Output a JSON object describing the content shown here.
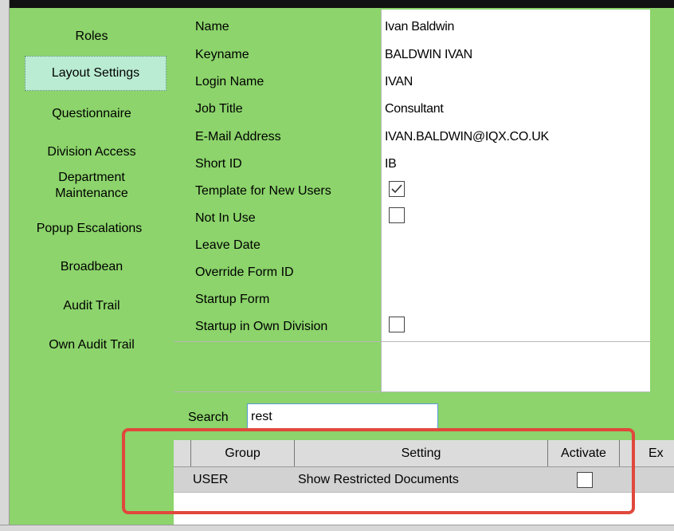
{
  "sidebar": {
    "items": [
      {
        "label": "Roles"
      },
      {
        "label": "Layout Settings"
      },
      {
        "label": "Questionnaire"
      },
      {
        "label": "Division Access"
      },
      {
        "label": "Department"
      },
      {
        "label": "Maintenance"
      },
      {
        "label": "Popup Escalations"
      },
      {
        "label": "Broadbean"
      },
      {
        "label": "Audit Trail"
      },
      {
        "label": "Own Audit Trail"
      }
    ]
  },
  "properties": [
    {
      "label": "Name",
      "value": "Ivan Baldwin"
    },
    {
      "label": "Keyname",
      "value": "BALDWIN IVAN"
    },
    {
      "label": "Login Name",
      "value": "IVAN"
    },
    {
      "label": "Job Title",
      "value": "Consultant"
    },
    {
      "label": "E-Mail Address",
      "value": "IVAN.BALDWIN@IQX.CO.UK"
    },
    {
      "label": "Short ID",
      "value": "IB"
    },
    {
      "label": "Template for New Users",
      "checked": true
    },
    {
      "label": "Not In Use",
      "checked": false
    },
    {
      "label": "Leave Date",
      "value": ""
    },
    {
      "label": "Override Form ID",
      "value": ""
    },
    {
      "label": "Startup Form",
      "value": ""
    },
    {
      "label": "Startup in Own Division",
      "checked": false
    }
  ],
  "search": {
    "label": "Search",
    "value": "rest"
  },
  "grid": {
    "columns": [
      {
        "label": "Group"
      },
      {
        "label": "Setting"
      },
      {
        "label": "Activate"
      },
      {
        "label": "Ex"
      }
    ],
    "rows": [
      {
        "group": "USER",
        "setting": "Show Restricted Documents",
        "activate": false
      }
    ]
  },
  "colors": {
    "panel_green": "#8cd46b",
    "highlight_red": "#e0483c",
    "active_item_bg": "#b9ecd2"
  }
}
